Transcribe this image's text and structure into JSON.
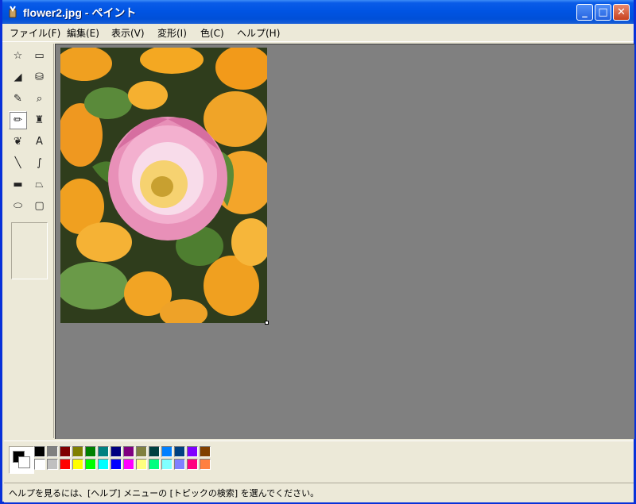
{
  "window": {
    "title": "flower2.jpg - ペイント",
    "minimize_label": "_",
    "maximize_label": "□",
    "close_label": "✕"
  },
  "menu": {
    "items": [
      {
        "label": "ファイル(F)"
      },
      {
        "label": "編集(E)"
      },
      {
        "label": "表示(V)"
      },
      {
        "label": "変形(I)"
      },
      {
        "label": "色(C)"
      },
      {
        "label": "ヘルプ(H)"
      }
    ]
  },
  "toolbox": {
    "tools": [
      {
        "icon": "free-form-select-icon",
        "glyph": "☆"
      },
      {
        "icon": "rect-select-icon",
        "glyph": "▭"
      },
      {
        "icon": "eraser-icon",
        "glyph": "◢"
      },
      {
        "icon": "fill-bucket-icon",
        "glyph": "⛁"
      },
      {
        "icon": "color-picker-icon",
        "glyph": "✎"
      },
      {
        "icon": "magnifier-icon",
        "glyph": "⌕"
      },
      {
        "icon": "pencil-icon",
        "glyph": "✏"
      },
      {
        "icon": "brush-icon",
        "glyph": "♜"
      },
      {
        "icon": "airbrush-icon",
        "glyph": "❦"
      },
      {
        "icon": "text-icon",
        "glyph": "A"
      },
      {
        "icon": "line-icon",
        "glyph": "╲"
      },
      {
        "icon": "curve-icon",
        "glyph": "∫"
      },
      {
        "icon": "rectangle-icon",
        "glyph": "▬"
      },
      {
        "icon": "polygon-icon",
        "glyph": "⏢"
      },
      {
        "icon": "ellipse-icon",
        "glyph": "⬭"
      },
      {
        "icon": "rounded-rect-icon",
        "glyph": "▢"
      }
    ],
    "active_tool": "pencil-icon"
  },
  "palette": {
    "foreground": "#000000",
    "background": "#ffffff",
    "colors_top": [
      "#000000",
      "#808080",
      "#800000",
      "#808000",
      "#008000",
      "#008080",
      "#000080",
      "#800080",
      "#808040",
      "#004040",
      "#0080ff",
      "#004080",
      "#8000ff",
      "#804000"
    ],
    "colors_bottom": [
      "#ffffff",
      "#c0c0c0",
      "#ff0000",
      "#ffff00",
      "#00ff00",
      "#00ffff",
      "#0000ff",
      "#ff00ff",
      "#ffff80",
      "#00ff80",
      "#80ffff",
      "#8080ff",
      "#ff0080",
      "#ff8040"
    ]
  },
  "status": {
    "text": "ヘルプを見るには、[ヘルプ] メニューの [トピックの検索] を選んでください。"
  },
  "colors": {
    "titlebar": "#0054e3",
    "canvas_background": "#808080",
    "window_face": "#ece9d8"
  }
}
